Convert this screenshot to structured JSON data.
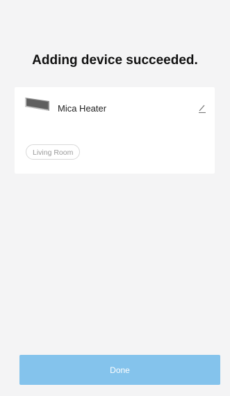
{
  "header": {
    "title": "Adding device succeeded."
  },
  "device": {
    "name": "Mica Heater",
    "room": "Living Room",
    "thumbnail_icon": "heater-icon",
    "edit_icon": "pencil-icon"
  },
  "footer": {
    "done_label": "Done"
  },
  "colors": {
    "background": "#f4f4f5",
    "card": "#ffffff",
    "button": "#84c3ec"
  }
}
